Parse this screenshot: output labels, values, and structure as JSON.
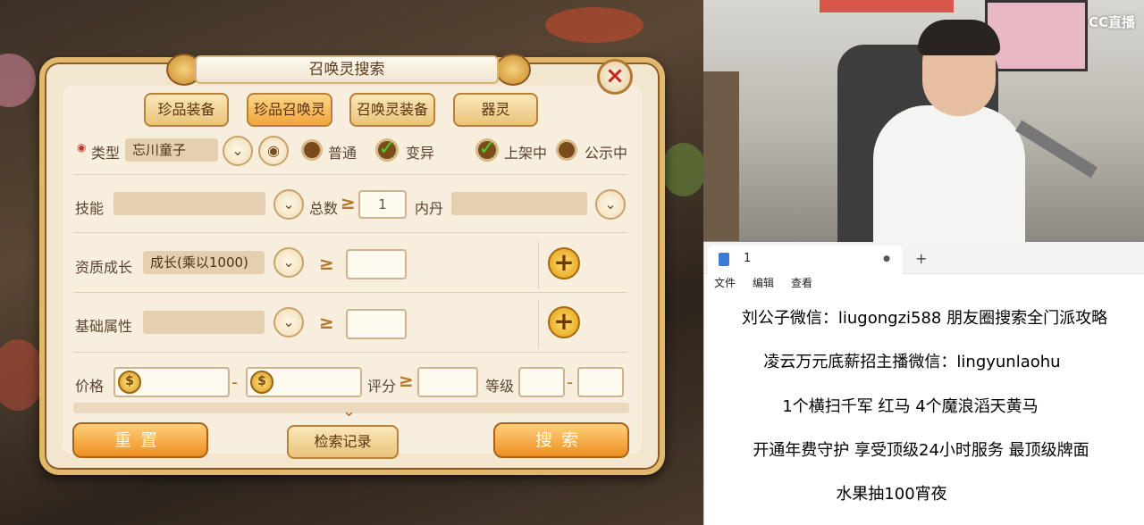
{
  "dialog": {
    "title": "召唤灵搜索",
    "close_icon": "×",
    "tabs": [
      "珍品装备",
      "珍品召唤灵",
      "召唤灵装备",
      "器灵"
    ],
    "active_tab": 1,
    "type_label": "类型",
    "type_value": "忘川童子",
    "filters": {
      "normal": "普通",
      "mutant": "变异",
      "listed": "上架中",
      "public": "公示中"
    },
    "skill_label": "技能",
    "total_label": "总数",
    "total_value": "1",
    "neidan_label": "内丹",
    "aptitude_label": "资质成长",
    "aptitude_value": "成长(乘以1000)",
    "ge_symbol": "≥",
    "base_label": "基础属性",
    "price_label": "价格",
    "price_dash": "-",
    "score_label": "评分",
    "level_label": "等级",
    "level_dash": "-",
    "reset_label": "重置",
    "history_label": "检索记录",
    "search_label": "搜索"
  },
  "stream": {
    "logo": "CC直播"
  },
  "notepad": {
    "tab_title": "1",
    "tab_dot": "●",
    "new_tab": "+",
    "menu": [
      "文件",
      "编辑",
      "查看"
    ],
    "lines": [
      "刘公子微信：liugongzi588 朋友圈搜索全门派攻略",
      "凌云万元底薪招主播微信：lingyunlaohu",
      "1个横扫千军 红马   4个魔浪滔天黄马",
      "开通年费守护 享受顶级24小时服务 最顶级牌面",
      "水果抽100宵夜"
    ]
  },
  "colors": {
    "accent": "#ee8f22",
    "check": "#4bd12a",
    "close": "#c8261c"
  }
}
